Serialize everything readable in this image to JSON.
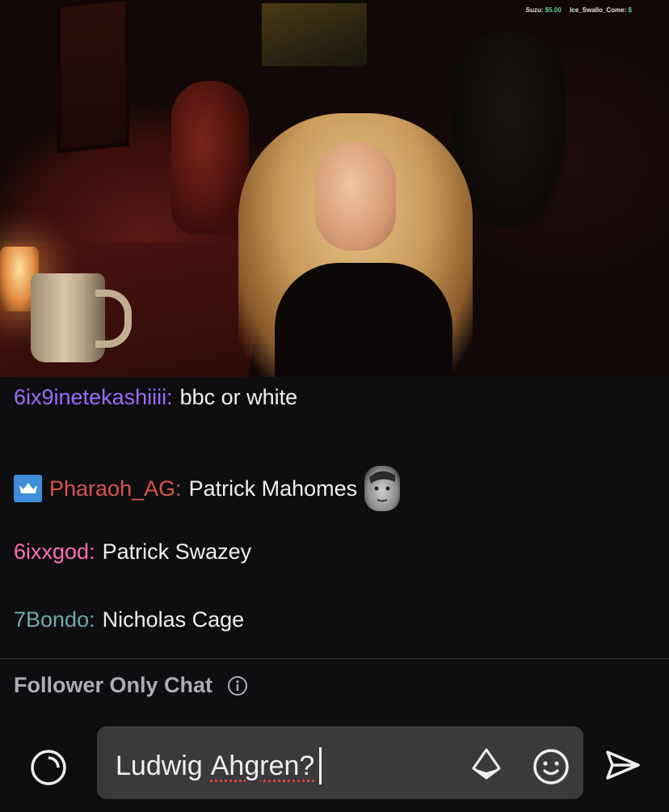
{
  "stream": {
    "overlay_user1": "Suzu:",
    "overlay_amount1": "$5.00",
    "overlay_user2": "Ice_Swallo_Come:",
    "overlay_amount2": "$"
  },
  "chat": {
    "messages": [
      {
        "user": "6ix9inetekashiiii:",
        "text": "bbc or white",
        "color": "#9147ff"
      },
      {
        "user": "Pharaoh_AG:",
        "text": "Patrick Mahomes",
        "color": "#e05050",
        "badge": "crown-badge",
        "emote": "face-emote"
      },
      {
        "user": "6ixxgod:",
        "text": "Patrick Swazey",
        "color": "#ff69b4"
      },
      {
        "user": "7Bondo:",
        "text": "Nicholas Cage",
        "color": "#5f9ea0"
      }
    ],
    "mode_label": "Follower Only Chat"
  },
  "input": {
    "word1": "Ludwig",
    "word2": "Ahgren?"
  },
  "icons": {
    "points": "channel-points-icon",
    "info": "info-icon",
    "bits": "bits-icon",
    "emote": "emote-picker-icon",
    "send": "send-icon"
  }
}
